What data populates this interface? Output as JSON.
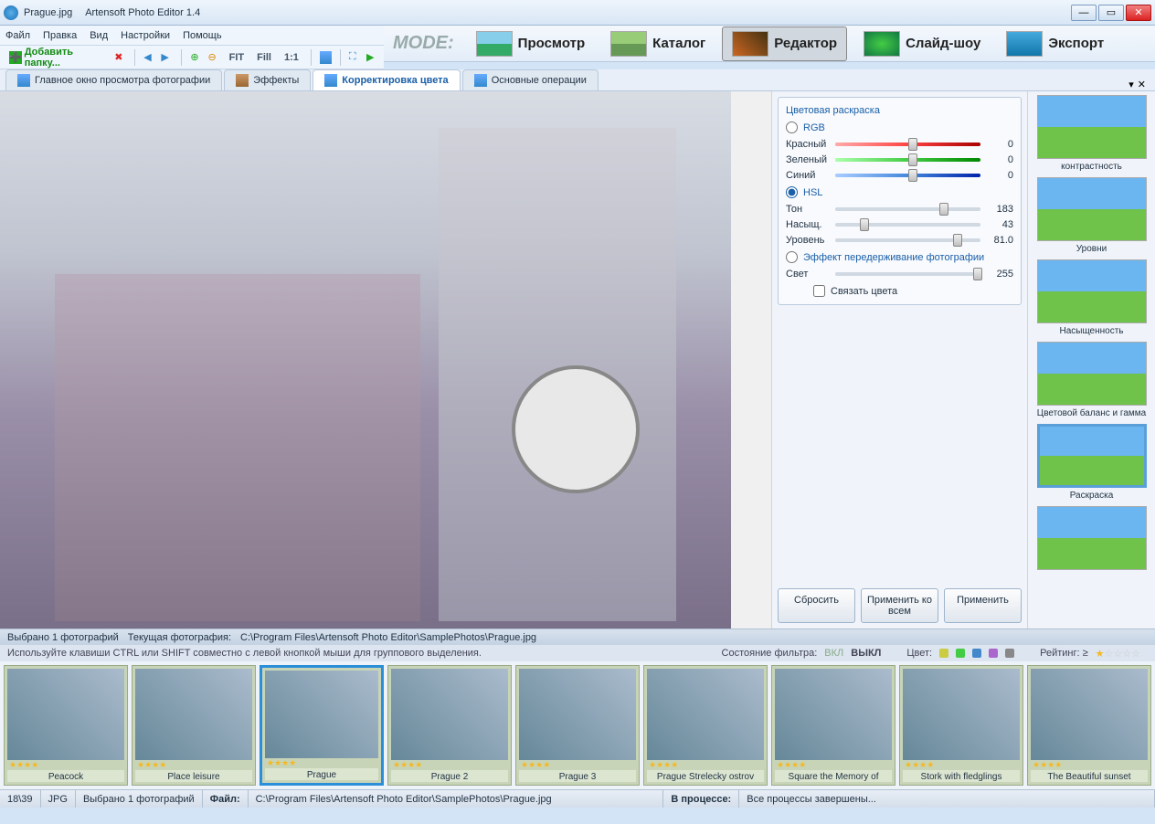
{
  "title": {
    "filename": "Prague.jpg",
    "app": "Artensoft Photo Editor 1.4"
  },
  "menu": {
    "file": "Файл",
    "edit": "Правка",
    "view": "Вид",
    "settings": "Настройки",
    "help": "Помощь"
  },
  "toolbar": {
    "add_folder": "Добавить папку...",
    "fit": "FIT",
    "fill": "Fill",
    "one": "1:1"
  },
  "mode": {
    "label": "MODE:",
    "view": "Просмотр",
    "catalog": "Каталог",
    "editor": "Редактор",
    "slideshow": "Слайд-шоу",
    "export": "Экспорт"
  },
  "tabs": {
    "main_window": "Главное окно просмотра фотографии",
    "effects": "Эффекты",
    "color_correct": "Корректировка цвета",
    "basic_ops": "Основные операции"
  },
  "color_panel": {
    "title": "Цветовая раскраска",
    "rgb": "RGB",
    "red": "Красный",
    "green": "Зеленый",
    "blue": "Синий",
    "rgb_values": {
      "red": "0",
      "green": "0",
      "blue": "0"
    },
    "hsl": "HSL",
    "hue": "Тон",
    "sat": "Насыщ.",
    "level": "Уровень",
    "hsl_values": {
      "hue": "183",
      "sat": "43",
      "level": "81.0"
    },
    "overexpose": "Эффект передерживание фотографии",
    "light": "Свет",
    "light_value": "255",
    "link_colors": "Связать цвета",
    "reset": "Сбросить",
    "apply_all": "Применить ко всем",
    "apply": "Применить"
  },
  "presets": [
    {
      "label": "контрастность",
      "sel": false
    },
    {
      "label": "Уровни",
      "sel": false
    },
    {
      "label": "Насыщенность",
      "sel": false
    },
    {
      "label": "Цветовой баланс и гамма",
      "sel": false
    },
    {
      "label": "Раскраска",
      "sel": true
    },
    {
      "label": "",
      "sel": false
    }
  ],
  "infobar": {
    "selected": "Выбрано 1  фотографий",
    "current": "Текущая фотография:",
    "path": "C:\\Program Files\\Artensoft Photo Editor\\SamplePhotos\\Prague.jpg"
  },
  "hint": "Используйте клавиши CTRL или SHIFT совместно с левой кнопкой мыши для группового выделения.",
  "filter": {
    "state_label": "Состояние фильтра:",
    "on": "ВКЛ",
    "off": "ВЫКЛ",
    "color_label": "Цвет:",
    "rating_label": "Рейтинг: ≥"
  },
  "thumbs": [
    {
      "name": "Peacock",
      "sel": false
    },
    {
      "name": "Place leisure",
      "sel": false
    },
    {
      "name": "Prague",
      "sel": true
    },
    {
      "name": "Prague 2",
      "sel": false
    },
    {
      "name": "Prague 3",
      "sel": false
    },
    {
      "name": "Prague Strelecky ostrov",
      "sel": false
    },
    {
      "name": "Square the Memory of",
      "sel": false
    },
    {
      "name": "Stork with fledglings",
      "sel": false
    },
    {
      "name": "The Beautiful sunset",
      "sel": false
    }
  ],
  "status": {
    "count": "18\\39",
    "format": "JPG",
    "sel": "Выбрано 1 фотографий",
    "file_label": "Файл:",
    "file_path": "C:\\Program Files\\Artensoft Photo Editor\\SamplePhotos\\Prague.jpg",
    "proc_label": "В процессе:",
    "proc_text": "Все процессы завершены..."
  }
}
